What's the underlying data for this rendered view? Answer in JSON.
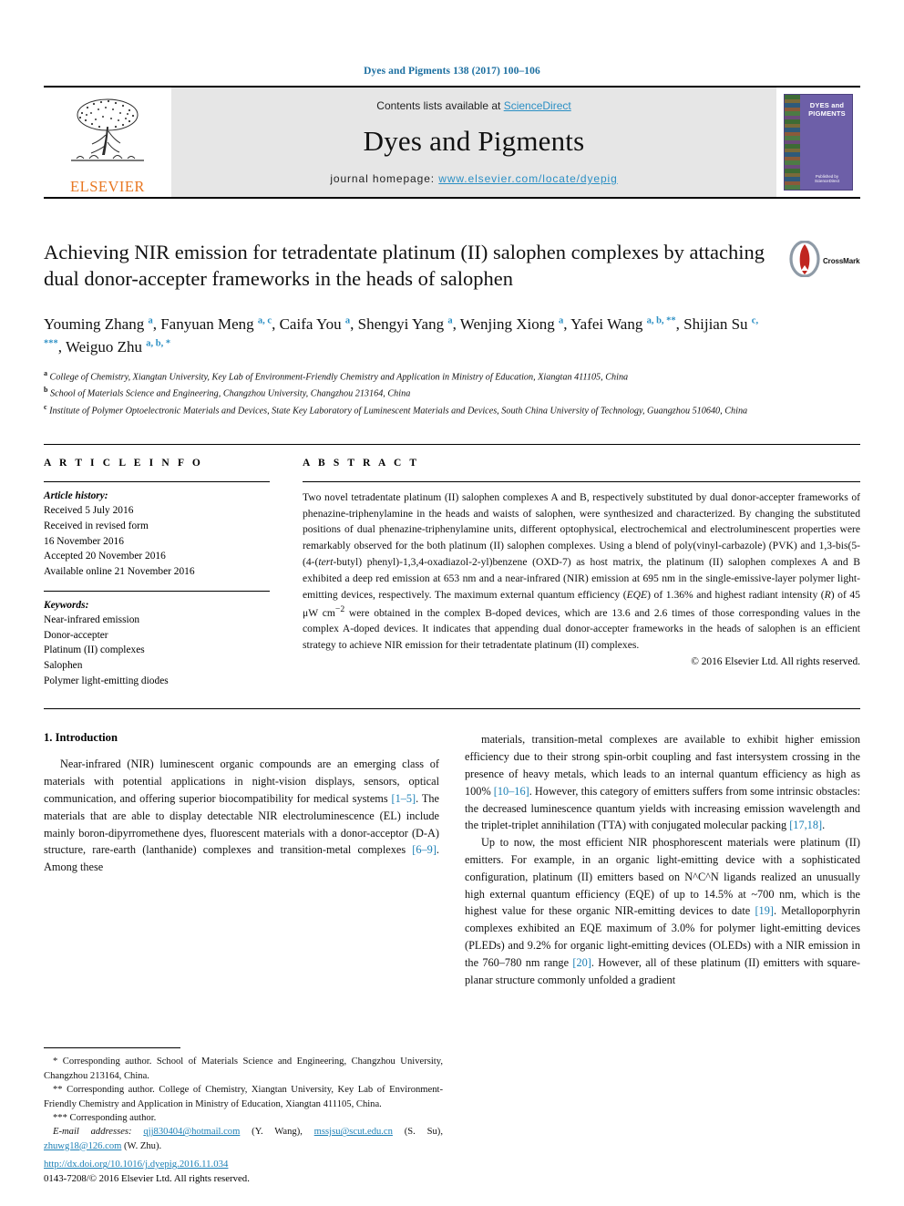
{
  "running_head": "Dyes and Pigments 138 (2017) 100–106",
  "masthead": {
    "publisher": "ELSEVIER",
    "contents_prefix": "Contents lists available at ",
    "contents_link": "ScienceDirect",
    "journal_title": "Dyes and Pigments",
    "homepage_prefix": "journal homepage: ",
    "homepage_url": "www.elsevier.com/locate/dyepig",
    "cover_title": "DYES and PIGMENTS",
    "cover_footer": "Published by ScienceDirect",
    "link_color": "#2b8fc4",
    "elsevier_orange": "#e87722"
  },
  "title": "Achieving NIR emission for tetradentate platinum (II) salophen complexes by attaching dual donor-accepter frameworks in the heads of salophen",
  "crossmark_label": "CrossMark",
  "authors": [
    {
      "name": "Youming Zhang",
      "sup": "a",
      "sep": ", "
    },
    {
      "name": "Fanyuan Meng",
      "sup": "a, c",
      "sep": ", "
    },
    {
      "name": "Caifa You",
      "sup": "a",
      "sep": ", "
    },
    {
      "name": "Shengyi Yang",
      "sup": "a",
      "sep": ", "
    },
    {
      "name": "Wenjing Xiong",
      "sup": "a",
      "sep": ", "
    },
    {
      "name": "Yafei Wang",
      "sup": "a, b, **",
      "sep": ", "
    },
    {
      "name": "Shijian Su",
      "sup": "c, ***",
      "sep": ", "
    },
    {
      "name": "Weiguo Zhu",
      "sup": "a, b, *",
      "sep": ""
    }
  ],
  "affiliations": [
    {
      "mark": "a",
      "text": "College of Chemistry, Xiangtan University, Key Lab of Environment-Friendly Chemistry and Application in Ministry of Education, Xiangtan 411105, China"
    },
    {
      "mark": "b",
      "text": "School of Materials Science and Engineering, Changzhou University, Changzhou 213164, China"
    },
    {
      "mark": "c",
      "text": "Institute of Polymer Optoelectronic Materials and Devices, State Key Laboratory of Luminescent Materials and Devices, South China University of Technology, Guangzhou 510640, China"
    }
  ],
  "article_info": {
    "heading": "A R T I C L E   I N F O",
    "history_label": "Article history:",
    "history": [
      "Received 5 July 2016",
      "Received in revised form",
      "16 November 2016",
      "Accepted 20 November 2016",
      "Available online 21 November 2016"
    ],
    "keywords_label": "Keywords:",
    "keywords": [
      "Near-infrared emission",
      "Donor-accepter",
      "Platinum (II) complexes",
      "Salophen",
      "Polymer light-emitting diodes"
    ]
  },
  "abstract": {
    "heading": "A B S T R A C T",
    "text": "Two novel tetradentate platinum (II) salophen complexes A and B, respectively substituted by dual donor-accepter frameworks of phenazine-triphenylamine in the heads and waists of salophen, were synthesized and characterized. By changing the substituted positions of dual phenazine-triphenylamine units, different optophysical, electrochemical and electroluminescent properties were remarkably observed for the both platinum (II) salophen complexes. Using a blend of poly(vinyl-carbazole) (PVK) and 1,3-bis(5-(4-(tert-butyl) phenyl)-1,3,4-oxadiazol-2-yl)benzene (OXD-7) as host matrix, the platinum (II) salophen complexes A and B exhibited a deep red emission at 653 nm and a near-infrared (NIR) emission at 695 nm in the single-emissive-layer polymer light-emitting devices, respectively. The maximum external quantum efficiency (EQE) of 1.36% and highest radiant intensity (R) of 45 μW cm−2 were obtained in the complex B-doped devices, which are 13.6 and 2.6 times of those corresponding values in the complex A-doped devices. It indicates that appending dual donor-accepter frameworks in the heads of salophen is an efficient strategy to achieve NIR emission for their tetradentate platinum (II) complexes.",
    "copyright": "© 2016 Elsevier Ltd. All rights reserved."
  },
  "body": {
    "section_heading": "1. Introduction",
    "left_paragraph": "Near-infrared (NIR) luminescent organic compounds are an emerging class of materials with potential applications in night-vision displays, sensors, optical communication, and offering superior biocompatibility for medical systems [1–5]. The materials that are able to display detectable NIR electroluminescence (EL) include mainly boron-dipyrromethene dyes, fluorescent materials with a donor-acceptor (D-A) structure, rare-earth (lanthanide) complexes and transition-metal complexes [6–9]. Among these",
    "right_paragraph_1": "materials, transition-metal complexes are available to exhibit higher emission efficiency due to their strong spin-orbit coupling and fast intersystem crossing in the presence of heavy metals, which leads to an internal quantum efficiency as high as 100% [10–16]. However, this category of emitters suffers from some intrinsic obstacles: the decreased luminescence quantum yields with increasing emission wavelength and the triplet-triplet annihilation (TTA) with conjugated molecular packing [17,18].",
    "right_paragraph_2": "Up to now, the most efficient NIR phosphorescent materials were platinum (II) emitters. For example, in an organic light-emitting device with a sophisticated configuration, platinum (II) emitters based on N^C^N ligands realized an unusually high external quantum efficiency (EQE) of up to 14.5% at ~700 nm, which is the highest value for these organic NIR-emitting devices to date [19]. Metalloporphyrin complexes exhibited an EQE maximum of 3.0% for polymer light-emitting devices (PLEDs) and 9.2% for organic light-emitting devices (OLEDs) with a NIR emission in the 760–780 nm range [20]. However, all of these platinum (II) emitters with square-planar structure commonly unfolded a gradient"
  },
  "footnotes": {
    "fn1": "* Corresponding author. School of Materials Science and Engineering, Changzhou University, Changzhou 213164, China.",
    "fn2": "** Corresponding author. College of Chemistry, Xiangtan University, Key Lab of Environment-Friendly Chemistry and Application in Ministry of Education, Xiangtan 411105, China.",
    "fn3": "*** Corresponding author.",
    "email_label": "E-mail addresses:",
    "emails": [
      {
        "addr": "qjj830404@hotmail.com",
        "who": "(Y. Wang)"
      },
      {
        "addr": "mssjsu@scut.edu.cn",
        "who": "(S. Su)"
      },
      {
        "addr": "zhuwg18@126.com",
        "who": "(W. Zhu)"
      }
    ]
  },
  "doi": {
    "url": "http://dx.doi.org/10.1016/j.dyepig.2016.11.034",
    "issn_line": "0143-7208/© 2016 Elsevier Ltd. All rights reserved."
  }
}
